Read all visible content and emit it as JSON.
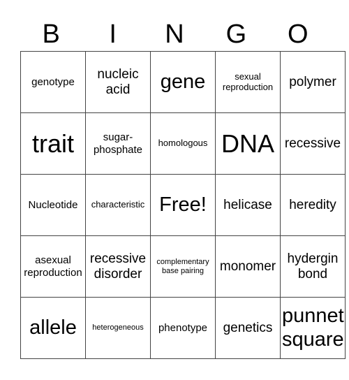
{
  "header": [
    "B",
    "I",
    "N",
    "G",
    "O"
  ],
  "rows": [
    [
      {
        "text": "genotype",
        "size": "md"
      },
      {
        "text": "nucleic acid",
        "size": "lg"
      },
      {
        "text": "gene",
        "size": "xl"
      },
      {
        "text": "sexual reproduction",
        "size": "sm"
      },
      {
        "text": "polymer",
        "size": "lg"
      }
    ],
    [
      {
        "text": "trait",
        "size": "xxl"
      },
      {
        "text": "sugar-phosphate",
        "size": "md"
      },
      {
        "text": "homologous",
        "size": "sm"
      },
      {
        "text": "DNA",
        "size": "xxl"
      },
      {
        "text": "recessive",
        "size": "lg"
      }
    ],
    [
      {
        "text": "Nucleotide",
        "size": "md"
      },
      {
        "text": "characteristic",
        "size": "sm"
      },
      {
        "text": "Free!",
        "size": "xl"
      },
      {
        "text": "helicase",
        "size": "lg"
      },
      {
        "text": "heredity",
        "size": "lg"
      }
    ],
    [
      {
        "text": "asexual reproduction",
        "size": "md"
      },
      {
        "text": "recessive disorder",
        "size": "lg"
      },
      {
        "text": "complementary base pairing",
        "size": "xs"
      },
      {
        "text": "monomer",
        "size": "lg"
      },
      {
        "text": "hydergin bond",
        "size": "lg"
      }
    ],
    [
      {
        "text": "allele",
        "size": "xl"
      },
      {
        "text": "heterogeneous",
        "size": "xs"
      },
      {
        "text": "phenotype",
        "size": "md"
      },
      {
        "text": "genetics",
        "size": "lg"
      },
      {
        "text": "punnet square",
        "size": "xl"
      }
    ]
  ]
}
